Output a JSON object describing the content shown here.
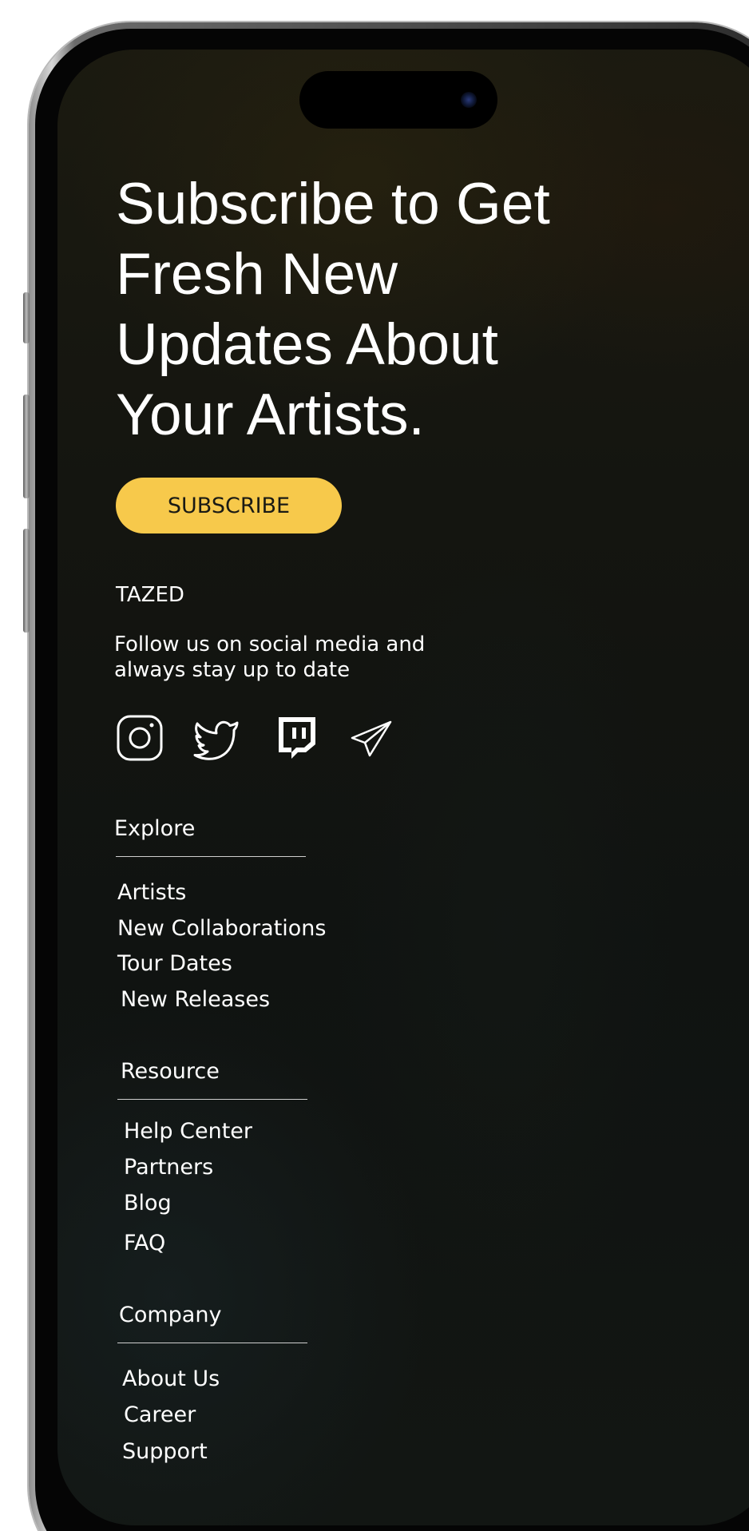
{
  "headline": "Subscribe to Get Fresh New Updates About Your Artists.",
  "subscribe_button": "SUBSCRIBE",
  "brand": "TAZED",
  "follow_text": "Follow us on social media and always stay up to date",
  "socials": [
    {
      "icon": "instagram-icon"
    },
    {
      "icon": "twitter-icon"
    },
    {
      "icon": "twitch-icon"
    },
    {
      "icon": "telegram-icon"
    }
  ],
  "footer": {
    "explore": {
      "title": "Explore",
      "links": [
        "Artists",
        "New Collaborations",
        "Tour Dates",
        "New Releases"
      ]
    },
    "resource": {
      "title": "Resource",
      "links": [
        "Help Center",
        "Partners",
        "Blog",
        "FAQ"
      ]
    },
    "company": {
      "title": "Company",
      "links": [
        "About Us",
        "Career",
        "Support"
      ]
    }
  },
  "colors": {
    "accent": "#f7c94b",
    "background": "#141510",
    "text": "#ffffff"
  }
}
